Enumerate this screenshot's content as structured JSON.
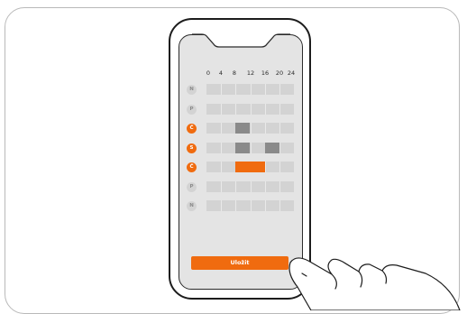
{
  "hours": [
    "0",
    "4",
    "8",
    "12",
    "16",
    "20",
    "24"
  ],
  "days": [
    {
      "label": "N",
      "active": false,
      "blocks": []
    },
    {
      "label": "P",
      "active": false,
      "blocks": []
    },
    {
      "label": "Č",
      "active": true,
      "blocks": [
        {
          "start": 8,
          "end": 12,
          "color": "#8a8a8a"
        }
      ]
    },
    {
      "label": "S",
      "active": true,
      "blocks": [
        {
          "start": 8,
          "end": 12,
          "color": "#8a8a8a"
        },
        {
          "start": 16,
          "end": 20,
          "color": "#8a8a8a"
        }
      ]
    },
    {
      "label": "Č",
      "active": true,
      "blocks": [
        {
          "start": 8,
          "end": 16,
          "color": "#f06b0f"
        }
      ]
    },
    {
      "label": "P",
      "active": false,
      "blocks": []
    },
    {
      "label": "N",
      "active": false,
      "blocks": []
    }
  ],
  "save_label": "Uložit",
  "colors": {
    "accent": "#f06b0f",
    "inactive_block": "#8a8a8a",
    "grid": "#d3d3d3"
  }
}
